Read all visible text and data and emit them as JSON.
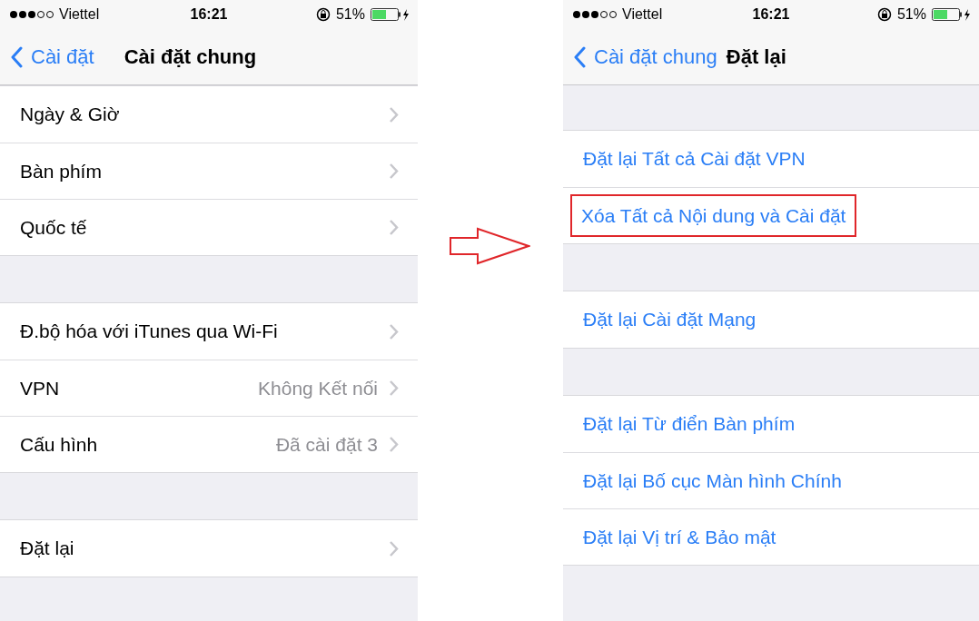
{
  "screens": [
    {
      "status_bar": {
        "carrier": "Viettel",
        "time": "16:21",
        "battery": "51%"
      },
      "nav": {
        "back": "Cài đặt",
        "title": "Cài đặt chung"
      },
      "groups": [
        [
          {
            "kind": "disclosure",
            "label": "Ngày & Giờ"
          },
          {
            "kind": "disclosure",
            "label": "Bàn phím"
          },
          {
            "kind": "disclosure",
            "label": "Quốc tế"
          }
        ],
        [
          {
            "kind": "disclosure",
            "label": "Đ.bộ hóa với iTunes qua Wi-Fi"
          },
          {
            "kind": "disclosure",
            "label": "VPN",
            "value": "Không Kết nối"
          },
          {
            "kind": "disclosure",
            "label": "Cấu hình",
            "value": "Đã cài đặt 3"
          }
        ],
        [
          {
            "kind": "disclosure",
            "label": "Đặt lại"
          }
        ]
      ]
    },
    {
      "status_bar": {
        "carrier": "Viettel",
        "time": "16:21",
        "battery": "51%"
      },
      "nav": {
        "back": "Cài đặt chung",
        "title": "Đặt lại"
      },
      "groups": [
        [
          {
            "kind": "action",
            "label": "Đặt lại Tất cả Cài đặt VPN",
            "highlighted": false
          },
          {
            "kind": "action",
            "label": "Xóa Tất cả Nội dung và Cài đặt",
            "highlighted": true
          }
        ],
        [
          {
            "kind": "action",
            "label": "Đặt lại Cài đặt Mạng",
            "highlighted": false
          }
        ],
        [
          {
            "kind": "action",
            "label": "Đặt lại Từ điển Bàn phím",
            "highlighted": false
          },
          {
            "kind": "action",
            "label": "Đặt lại Bố cục Màn hình Chính",
            "highlighted": false
          },
          {
            "kind": "action",
            "label": "Đặt lại Vị trí & Bảo mật",
            "highlighted": false
          }
        ]
      ]
    }
  ]
}
